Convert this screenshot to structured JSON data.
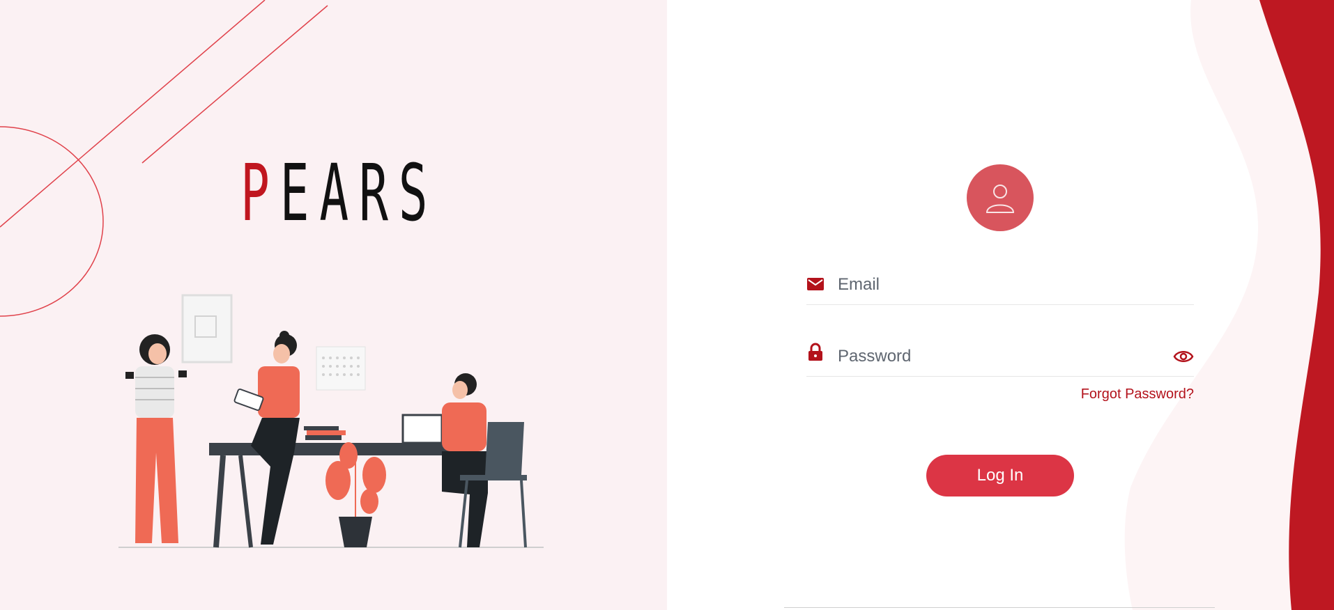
{
  "brand": {
    "logo_first": "P",
    "logo_rest": "EARS",
    "accent_color": "#c0161f",
    "button_color": "#dc3545"
  },
  "login": {
    "avatar_icon": "user-icon",
    "email": {
      "icon": "envelope-icon",
      "placeholder": "Email",
      "value": ""
    },
    "password": {
      "icon": "lock-icon",
      "placeholder": "Password",
      "value": "",
      "toggle_icon": "eye-icon"
    },
    "forgot_password_label": "Forgot Password?",
    "submit_label": "Log In"
  }
}
